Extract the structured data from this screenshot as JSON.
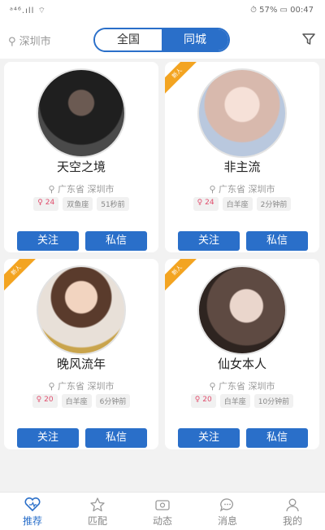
{
  "status_bar": {
    "left": "ᵃ⁴⁶.ıll ⌔",
    "right": "⏱ 57% ▭ 00:47"
  },
  "header": {
    "location": "深圳市",
    "tabs": [
      "全国",
      "同城"
    ],
    "active_tab": 1
  },
  "cards": [
    {
      "name": "天空之境",
      "province": "广东省",
      "city": "深圳市",
      "age": "24",
      "zodiac": "双鱼座",
      "time": "51秒前",
      "badge": "",
      "follow": "关注",
      "message": "私信",
      "avatar_color": "#2b2b2b"
    },
    {
      "name": "非主流",
      "province": "广东省",
      "city": "深圳市",
      "age": "24",
      "zodiac": "白羊座",
      "time": "2分钟前",
      "badge": "新人",
      "follow": "关注",
      "message": "私信",
      "avatar_color": "#e9d5cf"
    },
    {
      "name": "晚风流年",
      "province": "广东省",
      "city": "深圳市",
      "age": "20",
      "zodiac": "白羊座",
      "time": "6分钟前",
      "badge": "新人",
      "follow": "关注",
      "message": "私信",
      "avatar_color": "#d9c3a6"
    },
    {
      "name": "仙女本人",
      "province": "广东省",
      "city": "深圳市",
      "age": "20",
      "zodiac": "白羊座",
      "time": "10分钟前",
      "badge": "新人",
      "follow": "关注",
      "message": "私信",
      "avatar_color": "#5d4a44"
    }
  ],
  "tabbar": [
    {
      "label": "推荐",
      "icon": "recommend-icon"
    },
    {
      "label": "匹配",
      "icon": "match-icon"
    },
    {
      "label": "动态",
      "icon": "feed-icon"
    },
    {
      "label": "消息",
      "icon": "message-icon"
    },
    {
      "label": "我的",
      "icon": "profile-icon"
    }
  ],
  "colors": {
    "accent": "#2a6fc9",
    "badge": "#f3a421"
  }
}
